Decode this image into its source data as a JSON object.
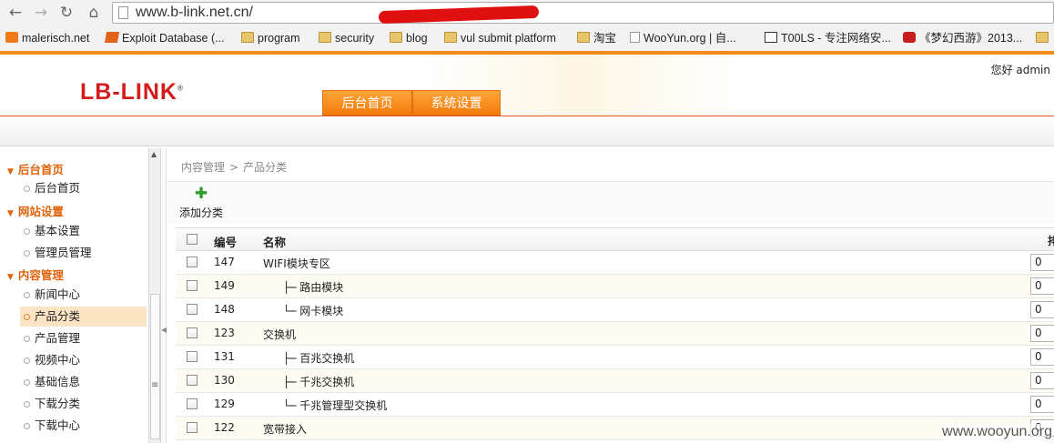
{
  "browser": {
    "url_text": "www.b-link.net.cn/",
    "bookmarks": [
      {
        "label": "malerisch.net",
        "icon": "blogger-icon"
      },
      {
        "label": "Exploit Database (...",
        "icon": "exploit-db-icon"
      },
      {
        "label": "program",
        "icon": "folder-icon"
      },
      {
        "label": "security",
        "icon": "folder-icon"
      },
      {
        "label": "blog",
        "icon": "folder-icon"
      },
      {
        "label": "vul submit platform",
        "icon": "folder-icon"
      },
      {
        "label": "淘宝",
        "icon": "folder-icon"
      },
      {
        "label": "WooYun.org | 自...",
        "icon": "page-icon"
      },
      {
        "label": "T00LS - 专注网络安...",
        "icon": "tools-icon"
      },
      {
        "label": "《梦幻西游》2013...",
        "icon": "game-icon"
      }
    ]
  },
  "header": {
    "logo": "LB-LINK",
    "logo_mark": "®",
    "greeting": "您好 admin",
    "nav": [
      "后台首页",
      "系统设置"
    ]
  },
  "sidebar": {
    "sections": [
      {
        "title": "后台首页",
        "items": [
          "后台首页"
        ]
      },
      {
        "title": "网站设置",
        "items": [
          "基本设置",
          "管理员管理"
        ]
      },
      {
        "title": "内容管理",
        "items": [
          "新闻中心",
          "产品分类",
          "产品管理",
          "视频中心",
          "基础信息",
          "下载分类",
          "下载中心"
        ]
      }
    ],
    "active_item": "产品分类"
  },
  "main": {
    "breadcrumb": [
      "内容管理",
      "产品分类"
    ],
    "breadcrumb_sep": ">",
    "add_button": "添加分类",
    "table": {
      "headers": {
        "id": "编号",
        "name": "名称",
        "order": "排"
      },
      "rows": [
        {
          "id": "147",
          "name": "WIFI模块专区",
          "order": "0"
        },
        {
          "id": "149",
          "name": "├─ 路由模块",
          "order": "0"
        },
        {
          "id": "148",
          "name": "└─ 网卡模块",
          "order": "0"
        },
        {
          "id": "123",
          "name": "交换机",
          "order": "0"
        },
        {
          "id": "131",
          "name": "├─ 百兆交换机",
          "order": "0"
        },
        {
          "id": "130",
          "name": "├─ 千兆交换机",
          "order": "0"
        },
        {
          "id": "129",
          "name": "└─ 千兆管理型交换机",
          "order": "0"
        },
        {
          "id": "122",
          "name": "宽带接入",
          "order": "0"
        }
      ]
    }
  },
  "watermark": "www.wooyun.org"
}
